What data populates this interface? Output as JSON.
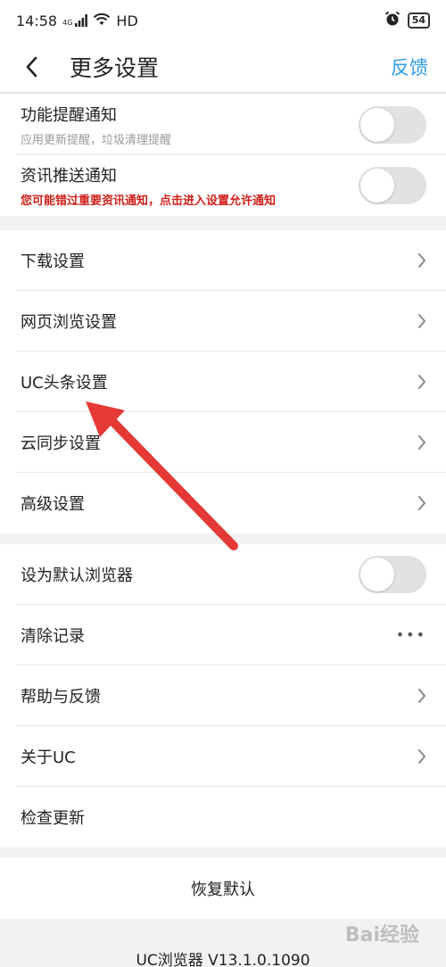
{
  "status": {
    "time": "14:58",
    "network": "4G",
    "hd": "HD",
    "battery": "54"
  },
  "nav": {
    "title": "更多设置",
    "feedback": "反馈"
  },
  "notifications": [
    {
      "title": "功能提醒通知",
      "subtitle": "应用更新提醒，垃圾清理提醒",
      "warn": false
    },
    {
      "title": "资讯推送通知",
      "subtitle": "您可能错过重要资讯通知，点击进入设置允许通知",
      "warn": true
    }
  ],
  "settings": {
    "items": [
      {
        "label": "下载设置"
      },
      {
        "label": "网页浏览设置"
      },
      {
        "label": "UC头条设置"
      },
      {
        "label": "云同步设置"
      },
      {
        "label": "高级设置"
      }
    ]
  },
  "misc": {
    "default_browser": "设为默认浏览器",
    "clear_records": "清除记录",
    "clear_dots": "•••",
    "help": "帮助与反馈",
    "about": "关于UC",
    "check_update": "检查更新"
  },
  "restore": {
    "label": "恢复默认"
  },
  "footer": {
    "version": "UC浏览器 V13.1.0.1090",
    "watermark": "Bai经验"
  },
  "colors": {
    "accent": "#2c9ee8",
    "warn": "#d0201a",
    "arrow": "#e53935"
  }
}
